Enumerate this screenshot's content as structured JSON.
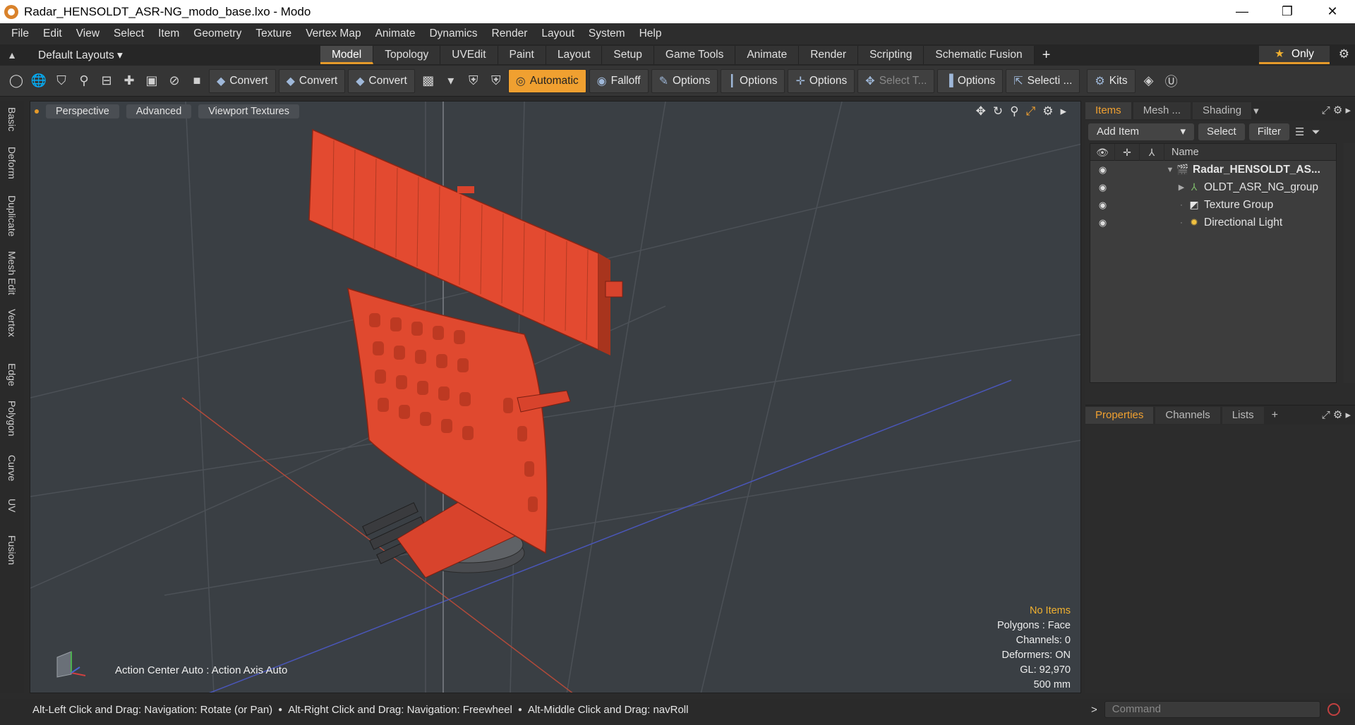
{
  "window": {
    "title": "Radar_HENSOLDT_ASR-NG_modo_base.lxo - Modo",
    "minimize": "—",
    "maximize": "❐",
    "close": "✕"
  },
  "menu": [
    "File",
    "Edit",
    "View",
    "Select",
    "Item",
    "Geometry",
    "Texture",
    "Vertex Map",
    "Animate",
    "Dynamics",
    "Render",
    "Layout",
    "System",
    "Help"
  ],
  "layout_bar": {
    "layout_select": "Default Layouts ▾",
    "tabs": [
      "Model",
      "Topology",
      "UVEdit",
      "Paint",
      "Layout",
      "Setup",
      "Game Tools",
      "Animate",
      "Render",
      "Scripting",
      "Schematic Fusion"
    ],
    "active_tab": "Model",
    "only_label": "Only"
  },
  "toolbar": {
    "convert1": "Convert",
    "convert2": "Convert",
    "convert3": "Convert",
    "automatic": "Automatic",
    "falloff": "Falloff",
    "options1": "Options",
    "options2": "Options",
    "options3": "Options",
    "select_t": "Select T...",
    "options4": "Options",
    "selecti": "Selecti ...",
    "kits": "Kits"
  },
  "left_tabs": [
    "Basic",
    "Deform",
    "Duplicate",
    "Mesh Edit",
    "Vertex",
    "Edge",
    "Polygon",
    "Curve",
    "UV",
    "Fusion"
  ],
  "viewport": {
    "perspective": "Perspective",
    "advanced": "Advanced",
    "textures": "Viewport Textures",
    "info": {
      "no_items": "No Items",
      "polygons": "Polygons : Face",
      "channels": "Channels: 0",
      "deformers": "Deformers: ON",
      "gl": "GL: 92,970",
      "scale": "500 mm"
    },
    "action_center": "Action Center Auto : Action Axis Auto",
    "model_color": "#e0492f"
  },
  "items_panel": {
    "tabs": [
      "Items",
      "Mesh ...",
      "Shading"
    ],
    "add_item": "Add Item",
    "select": "Select",
    "filter": "Filter",
    "name_header": "Name",
    "rows": [
      {
        "label": "Radar_HENSOLDT_AS...",
        "icon": "scene-icon"
      },
      {
        "label": "OLDT_ASR_NG_group",
        "icon": "group-icon"
      },
      {
        "label": "Texture Group",
        "icon": "texture-group-icon"
      },
      {
        "label": "Directional Light",
        "icon": "light-icon"
      }
    ]
  },
  "properties_panel": {
    "tabs": [
      "Properties",
      "Channels",
      "Lists"
    ]
  },
  "status": {
    "hint1": "Alt-Left Click and Drag: Navigation: Rotate (or Pan)",
    "hint2": "Alt-Right Click and Drag: Navigation: Freewheel",
    "hint3": "Alt-Middle Click and Drag: navRoll",
    "command_placeholder": "Command"
  }
}
